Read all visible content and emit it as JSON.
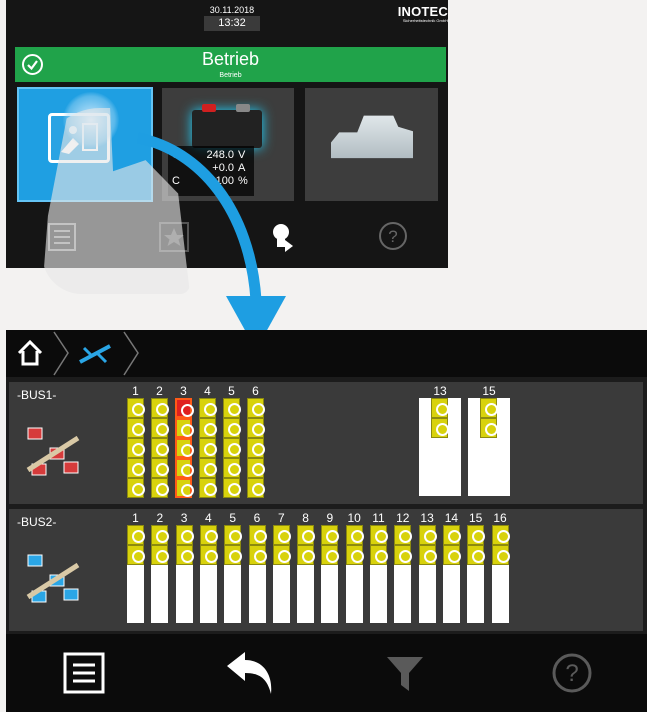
{
  "top_screen": {
    "date": "30.11.2018",
    "time": "13:32",
    "brand": "INOTEC",
    "brand_sub": "Sicherheitstechnik GmbH",
    "status": {
      "title": "Betrieb",
      "subtitle": "Betrieb",
      "color": "#20a34a"
    },
    "battery": {
      "rows": [
        {
          "label": "U",
          "value": "248.0",
          "unit": "V"
        },
        {
          "label": "",
          "value": "+0.0",
          "unit": "A"
        },
        {
          "label": "C",
          "value": "100",
          "unit": "%"
        }
      ]
    },
    "toolbar": [
      "menu-icon",
      "star-icon",
      "bulb-icon",
      "help-icon"
    ]
  },
  "bottom_screen": {
    "breadcrumb": [
      "home-icon",
      "bus-icon"
    ],
    "bus1": {
      "label": "-BUS1-",
      "columns": [
        {
          "num": "1",
          "cells": [
            0,
            1,
            2,
            3,
            4
          ],
          "red": [],
          "highlight": false
        },
        {
          "num": "2",
          "cells": [
            0,
            1,
            2,
            3,
            4
          ],
          "red": [],
          "highlight": false
        },
        {
          "num": "3",
          "cells": [
            0,
            1,
            2,
            3,
            4
          ],
          "red": [
            0
          ],
          "highlight": true
        },
        {
          "num": "4",
          "cells": [
            0,
            1,
            2,
            3,
            4
          ],
          "red": [],
          "highlight": false
        },
        {
          "num": "5",
          "cells": [
            0,
            1,
            2,
            3,
            4
          ],
          "red": [],
          "highlight": false
        },
        {
          "num": "6",
          "cells": [
            0,
            1,
            2,
            3,
            4
          ],
          "red": [],
          "highlight": false
        },
        {
          "num": "13",
          "cells": [
            0,
            1
          ],
          "red": [],
          "highlight": false
        },
        {
          "num": "15",
          "cells": [
            0,
            1
          ],
          "red": [],
          "highlight": false
        }
      ]
    },
    "bus2": {
      "label": "-BUS2-",
      "columns": [
        "1",
        "2",
        "3",
        "4",
        "5",
        "6",
        "7",
        "8",
        "9",
        "10",
        "11",
        "12",
        "13",
        "14",
        "15",
        "16"
      ]
    },
    "toolbar": [
      "menu-icon",
      "back-icon",
      "filter-icon",
      "help-icon"
    ]
  }
}
